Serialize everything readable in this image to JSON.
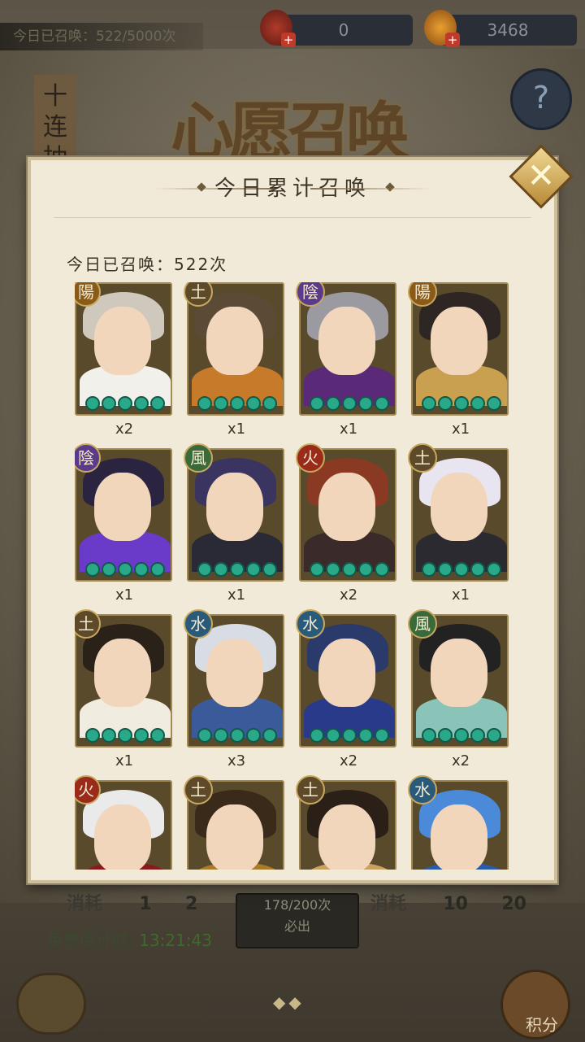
{
  "header": {
    "daily_summons": "今日已召唤：522/5000次",
    "resource_scroll": "0",
    "resource_coin": "3468",
    "add_label": "+",
    "help_label": "?",
    "side_title": "十连抽",
    "page_title": "心愿召唤"
  },
  "modal": {
    "title": "今日累计召唤",
    "summary": "今日已召唤：522次",
    "close_label": "✕"
  },
  "heroes": [
    {
      "element": "陽",
      "count": "x2",
      "elem_color": "#8a5a18",
      "hair": "#cfc8bd",
      "outfit": "#f2f0ea"
    },
    {
      "element": "土",
      "count": "x1",
      "elem_color": "#5e4a28",
      "hair": "#5a4a36",
      "outfit": "#c67a2a"
    },
    {
      "element": "陰",
      "count": "x1",
      "elem_color": "#5a3a8a",
      "hair": "#9a9aa0",
      "outfit": "#5a2a78"
    },
    {
      "element": "陽",
      "count": "x1",
      "elem_color": "#8a5a18",
      "hair": "#2e2622",
      "outfit": "#c8a050"
    },
    {
      "element": "陰",
      "count": "x1",
      "elem_color": "#5a3a8a",
      "hair": "#2a2440",
      "outfit": "#6a3ac8"
    },
    {
      "element": "風",
      "count": "x1",
      "elem_color": "#3a6a3a",
      "hair": "#3a3460",
      "outfit": "#2a2a36"
    },
    {
      "element": "火",
      "count": "x2",
      "elem_color": "#9a2a1a",
      "hair": "#8a3a22",
      "outfit": "#3a2a2a"
    },
    {
      "element": "土",
      "count": "x1",
      "elem_color": "#5e4a28",
      "hair": "#e8e4f0",
      "outfit": "#2a2a30"
    },
    {
      "element": "土",
      "count": "x1",
      "elem_color": "#5e4a28",
      "hair": "#2a2218",
      "outfit": "#f0ece0"
    },
    {
      "element": "水",
      "count": "x3",
      "elem_color": "#2a5a7a",
      "hair": "#d8dce4",
      "outfit": "#3a5a9a"
    },
    {
      "element": "水",
      "count": "x2",
      "elem_color": "#2a5a7a",
      "hair": "#2a3a6a",
      "outfit": "#2a3a8a"
    },
    {
      "element": "風",
      "count": "x2",
      "elem_color": "#3a6a3a",
      "hair": "#222222",
      "outfit": "#8ac4b8"
    },
    {
      "element": "火",
      "count": "",
      "elem_color": "#9a2a1a",
      "hair": "#eaeaea",
      "outfit": "#8a1a1a"
    },
    {
      "element": "土",
      "count": "",
      "elem_color": "#5e4a28",
      "hair": "#3a2a1a",
      "outfit": "#a87a2a"
    },
    {
      "element": "土",
      "count": "",
      "elem_color": "#5e4a28",
      "hair": "#2a2018",
      "outfit": "#c8a060"
    },
    {
      "element": "水",
      "count": "",
      "elem_color": "#2a5a7a",
      "hair": "#4a8ad8",
      "outfit": "#2a5aa8"
    }
  ],
  "footer": {
    "cost_label": "消耗",
    "cost_left_a": "1",
    "cost_left_b": "2",
    "cost_right_a": "10",
    "cost_right_b": "20",
    "pity_progress": "178/200次",
    "pity_label": "必出",
    "timer_label": "免费倒计时:",
    "timer_value": "13:21:43",
    "page_dots": "◆◆",
    "points_label": "积分"
  }
}
